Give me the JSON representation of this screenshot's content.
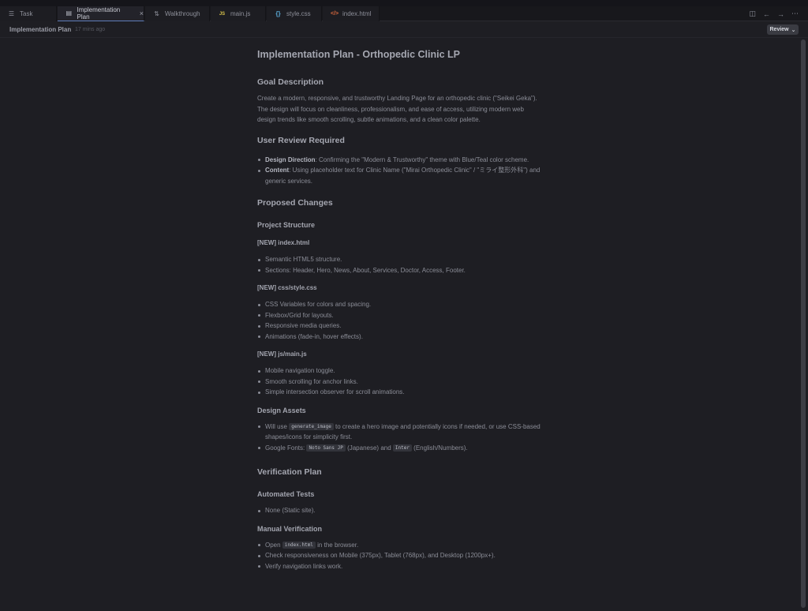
{
  "tabs": [
    {
      "label": "Task"
    },
    {
      "label": "Implementation Plan"
    },
    {
      "label": "Walkthrough"
    },
    {
      "label": "main.js"
    },
    {
      "label": "style.css"
    },
    {
      "label": "index.html"
    }
  ],
  "header": {
    "title": "Implementation Plan",
    "time": "17 mins ago",
    "review_label": "Review"
  },
  "doc": {
    "title": "Implementation Plan - Orthopedic Clinic LP",
    "goal": {
      "heading": "Goal Description",
      "text": "Create a modern, responsive, and trustworthy Landing Page for an orthopedic clinic (\"Seikei Geka\"). The design will focus on cleanliness, professionalism, and ease of access, utilizing modern web design trends like smooth scrolling, subtle animations, and a clean color palette."
    },
    "review": {
      "heading": "User Review Required",
      "items": [
        {
          "bold": "Design Direction",
          "text": ": Confirming the \"Modern & Trustworthy\" theme with Blue/Teal color scheme."
        },
        {
          "bold": "Content",
          "text": ": Using placeholder text for Clinic Name (\"Mirai Orthopedic Clinic\" / \"ミライ整形外科\") and generic services."
        }
      ]
    },
    "changes": {
      "heading": "Proposed Changes",
      "structure_heading": "Project Structure",
      "index": {
        "heading": "[NEW] index.html",
        "items": [
          "Semantic HTML5 structure.",
          "Sections: Header, Hero, News, About, Services, Doctor, Access, Footer."
        ]
      },
      "css": {
        "heading": "[NEW] css/style.css",
        "items": [
          "CSS Variables for colors and spacing.",
          "Flexbox/Grid for layouts.",
          "Responsive media queries.",
          "Animations (fade-in, hover effects)."
        ]
      },
      "js": {
        "heading": "[NEW] js/main.js",
        "items": [
          "Mobile navigation toggle.",
          "Smooth scrolling for anchor links.",
          "Simple intersection observer for scroll animations."
        ]
      },
      "assets": {
        "heading": "Design Assets",
        "item1": {
          "pre": "Will use ",
          "code": "generate_image",
          "post": " to create a hero image and potentially icons if needed, or use CSS-based shapes/icons for simplicity first."
        },
        "item2": {
          "pre": "Google Fonts: ",
          "code1": "Noto Sans JP",
          "mid": " (Japanese) and ",
          "code2": "Inter",
          "post": " (English/Numbers)."
        }
      }
    },
    "verification": {
      "heading": "Verification Plan",
      "auto_heading": "Automated Tests",
      "auto_items": [
        "None (Static site)."
      ],
      "manual_heading": "Manual Verification",
      "manual_item1": {
        "pre": "Open ",
        "code": "index.html",
        "post": " in the browser."
      },
      "manual_items": [
        "Check responsiveness on Mobile (375px), Tablet (768px), and Desktop (1200px+).",
        "Verify navigation links work."
      ]
    }
  }
}
